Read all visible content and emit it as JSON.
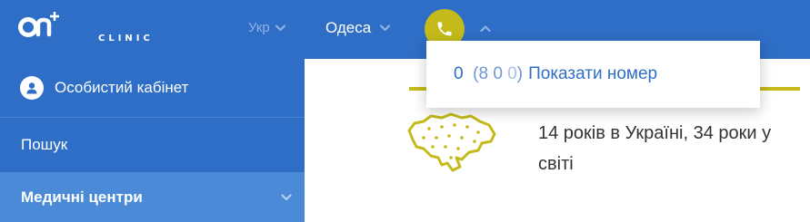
{
  "header": {
    "logo_text": "CLINIC",
    "language": "Укр",
    "city": "Одеса"
  },
  "phone_dropdown": {
    "prefix": "0",
    "open_paren": "(",
    "digit1": "8",
    "digit2": "0",
    "digit3": "0",
    "close_paren": ")",
    "show_label": "Показати номер"
  },
  "sidebar": {
    "items": [
      {
        "label": "Особистий кабінет",
        "icon": "user-icon"
      },
      {
        "label": "Пошук"
      },
      {
        "label": "Медичні центри",
        "icon": "chevron-down-icon"
      }
    ]
  },
  "main": {
    "stat_text": "14 років в Україні, 34 роки у світі",
    "icon": "ukraine-map-icon"
  },
  "colors": {
    "primary": "#2e6ec6",
    "accent": "#c4ba1a",
    "sidebar_active": "#4a8ad6"
  }
}
